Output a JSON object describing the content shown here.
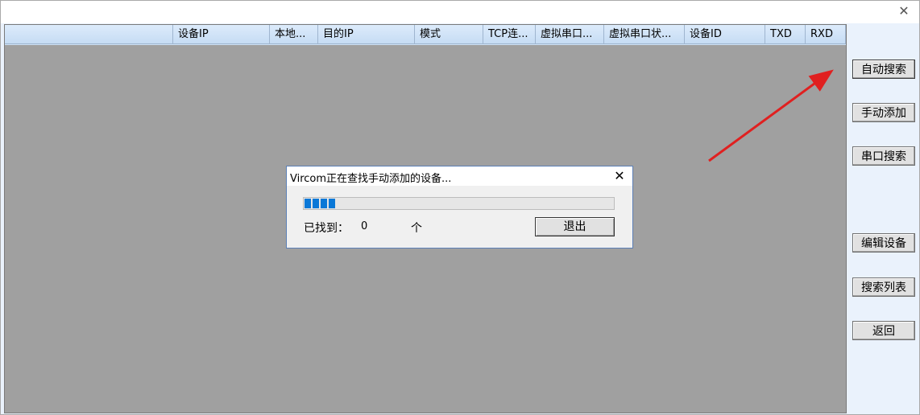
{
  "window": {
    "close_glyph": "✕"
  },
  "table": {
    "columns": [
      "",
      "设备IP",
      "本地...",
      "目的IP",
      "模式",
      "TCP连...",
      "虚拟串口...",
      "虚拟串口状...",
      "设备ID",
      "TXD",
      "RXD"
    ]
  },
  "sidebar": {
    "buttons": [
      "自动搜索",
      "手动添加",
      "串口搜索",
      "编辑设备",
      "搜索列表",
      "返回"
    ]
  },
  "dialog": {
    "title": "Vircom正在查找手动添加的设备...",
    "close_glyph": "✕",
    "progress_segments": 4,
    "found_label": "已找到：",
    "found_count": "0",
    "found_unit": "个",
    "exit_label": "退出"
  },
  "annotation": {
    "arrow_color": "#e02020"
  }
}
